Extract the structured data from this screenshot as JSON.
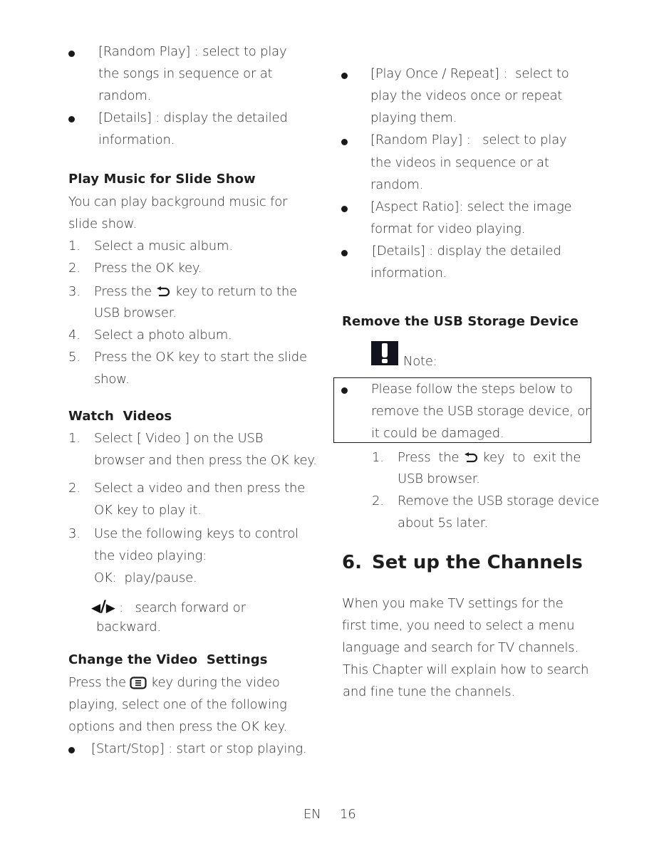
{
  "left_column": {
    "music_options": [
      {
        "lines": [
          "[Random Play] : select to play",
          "the songs in sequence or at",
          "random."
        ]
      },
      {
        "lines": [
          "[Details] : display the detailed",
          "information."
        ]
      }
    ],
    "slide_music": {
      "heading": "Play Music for Slide Show",
      "intro": [
        "You can play background music for",
        "slide show."
      ],
      "steps": [
        {
          "num": "1.",
          "lines": [
            "Select a music album."
          ]
        },
        {
          "num": "2.",
          "lines": [
            "Press the OK key."
          ]
        },
        {
          "num": "3.",
          "lines": [
            "Press the",
            "key to return to the",
            "USB browser."
          ],
          "icon": "back-icon"
        },
        {
          "num": "4.",
          "lines": [
            "Select a photo album."
          ]
        },
        {
          "num": "5.",
          "lines": [
            "Press the OK key to start the slide",
            "show."
          ]
        }
      ]
    },
    "watch_videos": {
      "heading": "Watch  Videos",
      "steps": [
        {
          "num": "1.",
          "lines": [
            "Select [ Video ] on the USB",
            "browser and then press the OK key."
          ]
        },
        {
          "num": "2.",
          "lines": [
            "Select a video and then press the",
            "OK key to play it."
          ]
        },
        {
          "num": "3.",
          "lines": [
            "Use the following keys to control",
            "the video playing:",
            "OK:  play/pause."
          ]
        }
      ],
      "search_keys": {
        "left_arrow": "◀",
        "slash": "/",
        "right_arrow": "▶",
        "text": ":   search forward or",
        "text2": "backward."
      }
    },
    "video_settings": {
      "heading": "Change the Video  Settings",
      "intro": [
        "Press the",
        "key during the video",
        "playing, select one of the following",
        "options and then press the OK key."
      ],
      "options": [
        {
          "lines": [
            "[Start/Stop] : start or stop playing."
          ]
        }
      ]
    }
  },
  "right_column": {
    "video_options": [
      {
        "lines": [
          "[Play Once / Repeat] :  select to",
          "play the videos once or repeat",
          "playing them."
        ]
      },
      {
        "lines": [
          "[Random Play] :   select to play",
          "the videos in sequence or at",
          "random."
        ]
      },
      {
        "lines": [
          "[Aspect Ratio]: select the image",
          "format for video playing."
        ]
      },
      {
        "lines": [
          "[Details] : display the detailed",
          "information."
        ]
      }
    ],
    "remove_usb": {
      "heading": "Remove the USB Storage Device",
      "note_label": "Note:",
      "note_lines": [
        "Please follow the steps below to",
        "remove the USB storage device, or",
        "it could be damaged."
      ],
      "steps": [
        {
          "num": "1.",
          "lines": [
            "Press  the",
            "key  to  exit the",
            "USB browser."
          ],
          "icon": "back-icon"
        },
        {
          "num": "2.",
          "lines": [
            "Remove the USB storage device",
            "about 5s later."
          ]
        }
      ]
    },
    "chapter": {
      "number": "6.",
      "title": "Set up the Channels",
      "body": [
        "When you make TV settings for the",
        "first time, you need to select a menu",
        "language and search for TV channels.",
        "This Chapter will explain how to search",
        "and fine tune the channels."
      ]
    }
  },
  "footer": {
    "language": "EN",
    "page_number": "16"
  }
}
